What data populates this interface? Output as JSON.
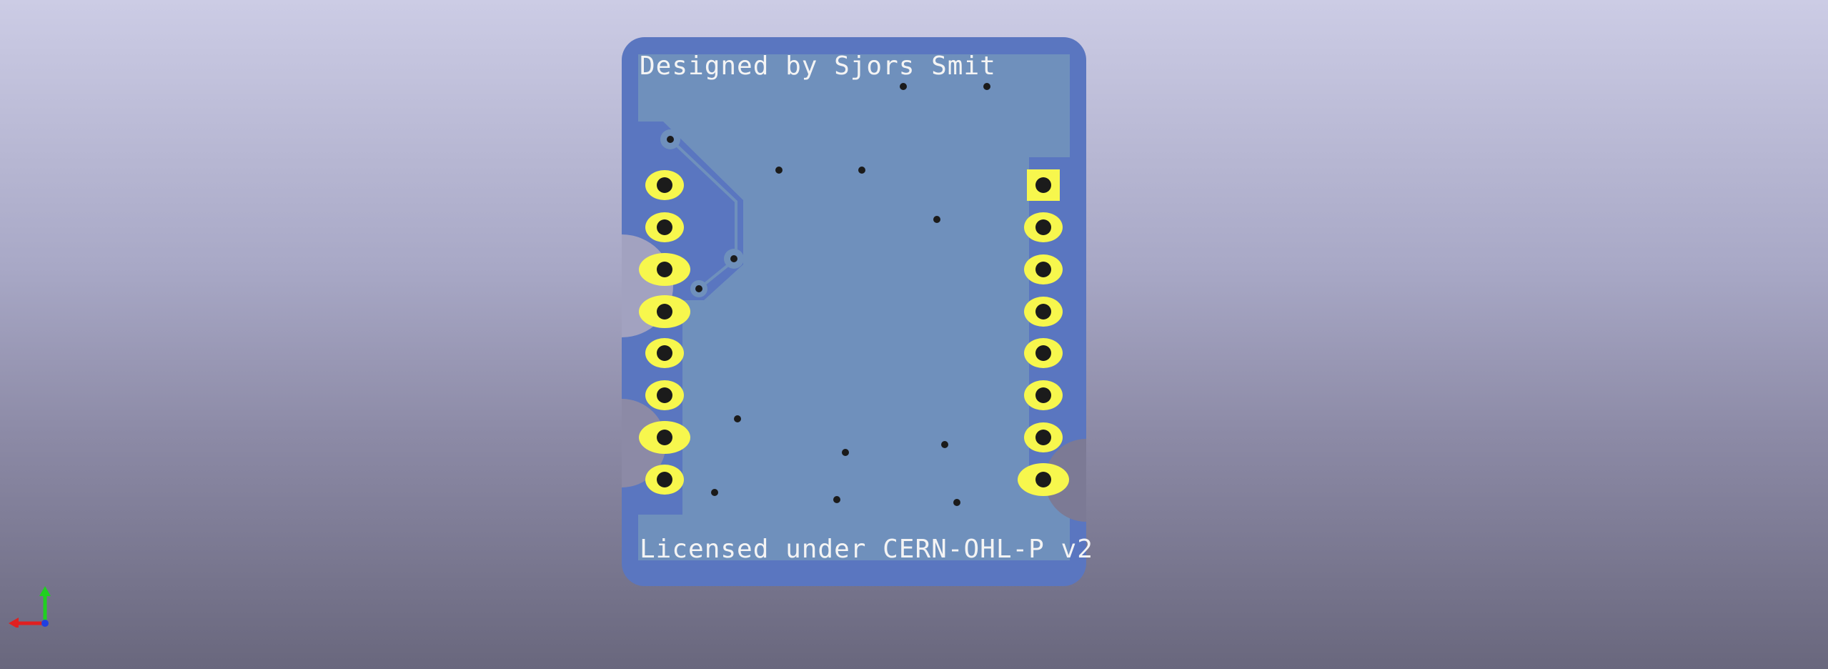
{
  "viewer": {
    "mode": "3D viewer - bottom view"
  },
  "silkscreen": {
    "top_text": "Designed by Sjors Smit",
    "bottom_text": "Licensed under CERN-OHL-P v2"
  },
  "colors": {
    "board_outer": "#5a76c0",
    "board_inner": "#6f90bc",
    "copper_pad": "#f7f74d",
    "drill": "#1b1b1b",
    "silk": "#f4f4f4",
    "axis_x": "#e02020",
    "axis_y": "#20d020",
    "axis_z": "#2040e0"
  },
  "headers": {
    "left_pin_count": 8,
    "right_pin_count": 8,
    "right_square_pad": "pin-1"
  },
  "axis_gizmo": {
    "icons": [
      "axis-x-arrow-icon",
      "axis-y-arrow-icon",
      "axis-z-dot-icon"
    ]
  }
}
